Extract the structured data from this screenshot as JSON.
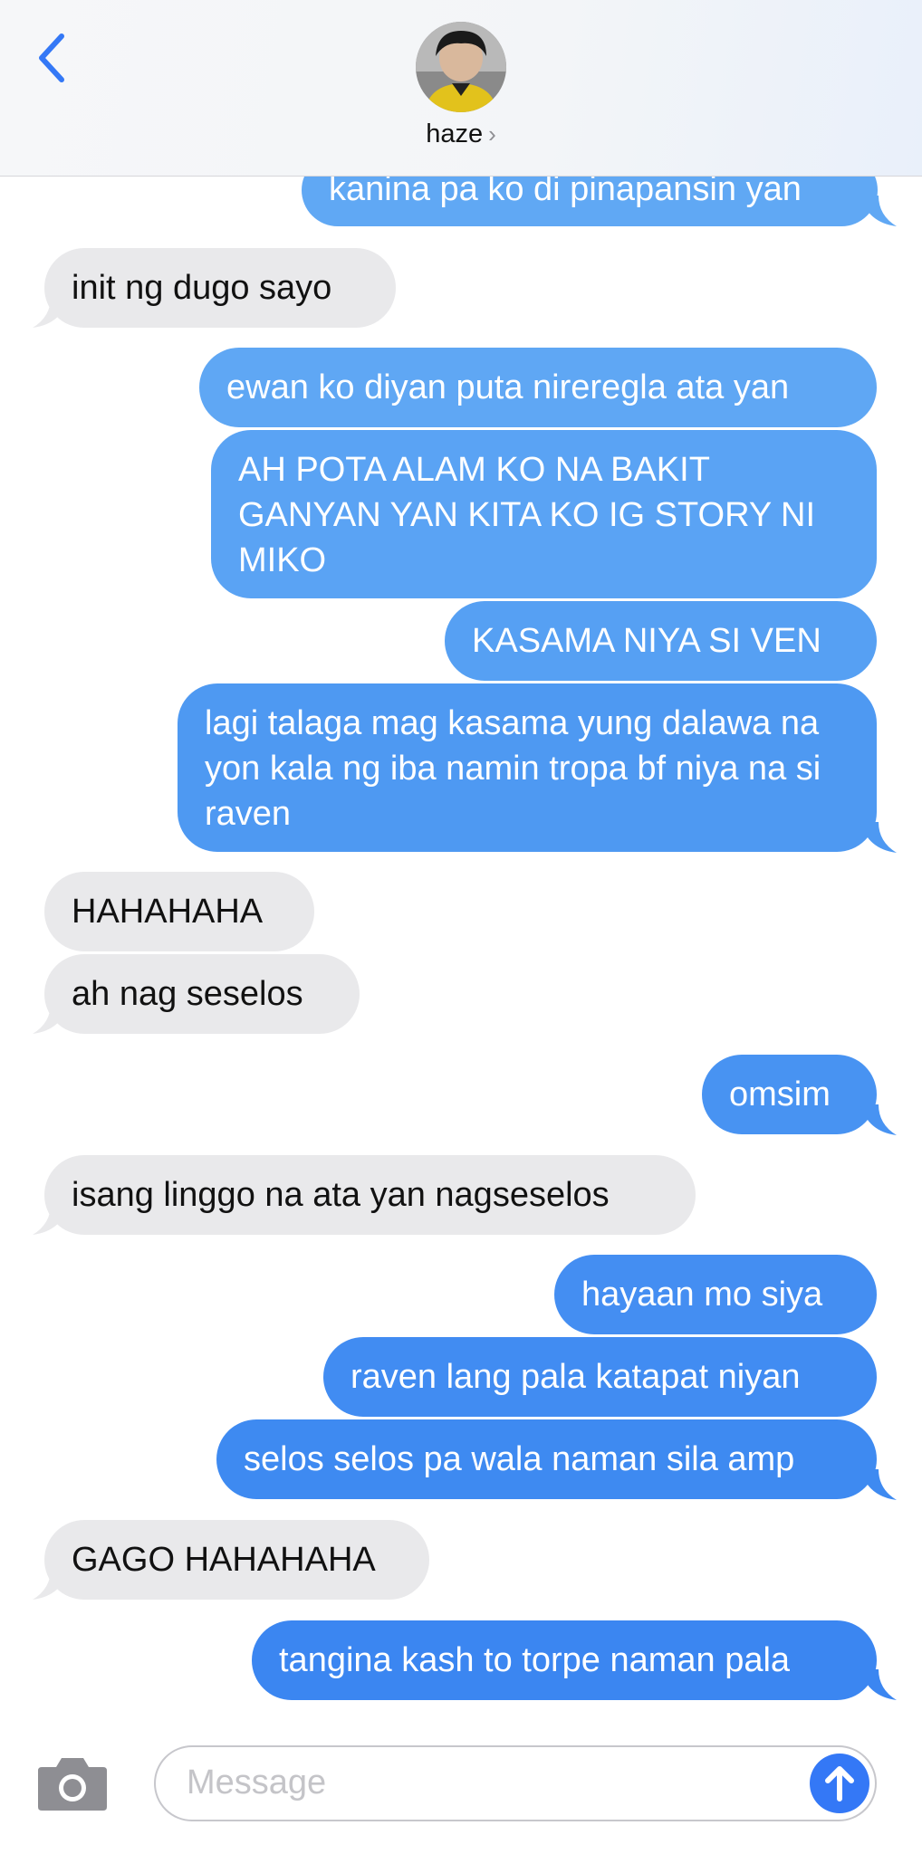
{
  "header": {
    "contact_name": "haze",
    "chevron": "›"
  },
  "messages": [
    {
      "dir": "out",
      "text": "kanina pa ko di pinapansin yan"
    },
    {
      "dir": "in",
      "text": "init ng dugo sayo"
    },
    {
      "dir": "out",
      "text": "ewan ko diyan puta nireregla ata yan"
    },
    {
      "dir": "out",
      "text": "AH POTA ALAM KO NA BAKIT GANYAN YAN KITA KO IG STORY NI MIKO"
    },
    {
      "dir": "out",
      "text": "KASAMA NIYA SI VEN"
    },
    {
      "dir": "out",
      "text": "lagi talaga mag kasama yung dalawa na yon kala ng iba namin tropa bf niya na si raven"
    },
    {
      "dir": "in",
      "text": "HAHAHAHA"
    },
    {
      "dir": "in",
      "text": "ah nag seselos"
    },
    {
      "dir": "out",
      "text": "omsim"
    },
    {
      "dir": "in",
      "text": "isang linggo na ata yan nagseselos"
    },
    {
      "dir": "out",
      "text": "hayaan mo siya"
    },
    {
      "dir": "out",
      "text": "raven lang pala katapat niyan"
    },
    {
      "dir": "out",
      "text": "selos selos pa wala naman sila amp"
    },
    {
      "dir": "in",
      "text": "GAGO HAHAHAHA"
    },
    {
      "dir": "out",
      "text": "tangina kash to torpe naman pala"
    }
  ],
  "composer": {
    "placeholder": "Message"
  },
  "colors": {
    "outgoing_top": "#63aaf4",
    "outgoing_bottom": "#3b82f1",
    "incoming": "#e9e9eb",
    "accent": "#3478f6"
  },
  "icons": [
    "back-chevron-icon",
    "camera-icon",
    "send-arrow-icon"
  ]
}
